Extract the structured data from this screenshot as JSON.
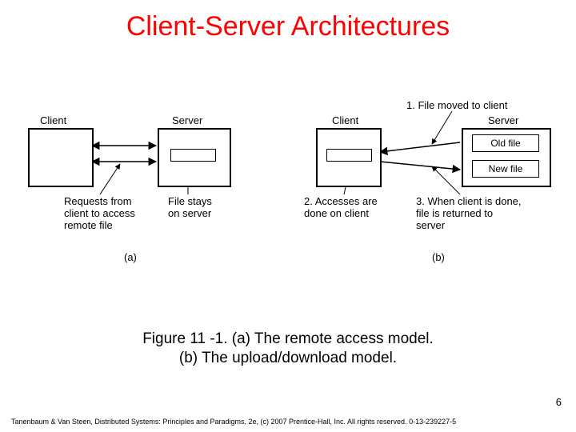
{
  "title": "Client-Server Architectures",
  "diagram": {
    "a": {
      "client_label": "Client",
      "server_label": "Server",
      "requests_label": "Requests from\nclient to access\nremote file",
      "file_stays_label": "File stays\non server",
      "subfig_label": "(a)"
    },
    "b": {
      "client_label": "Client",
      "server_label": "Server",
      "old_file_label": "Old file",
      "new_file_label": "New file",
      "step1_label": "1. File moved to client",
      "step2_label": "2. Accesses are\ndone on client",
      "step3_label": "3. When client is done,\nfile is returned to\nserver",
      "subfig_label": "(b)"
    }
  },
  "caption_line1": "Figure 11 -1. (a) The remote access model.",
  "caption_line2": "(b) The upload/download model.",
  "page_number": "6",
  "footer": "Tanenbaum & Van Steen, Distributed Systems: Principles and Paradigms, 2e, (c) 2007 Prentice-Hall, Inc. All rights reserved. 0-13-239227-5"
}
